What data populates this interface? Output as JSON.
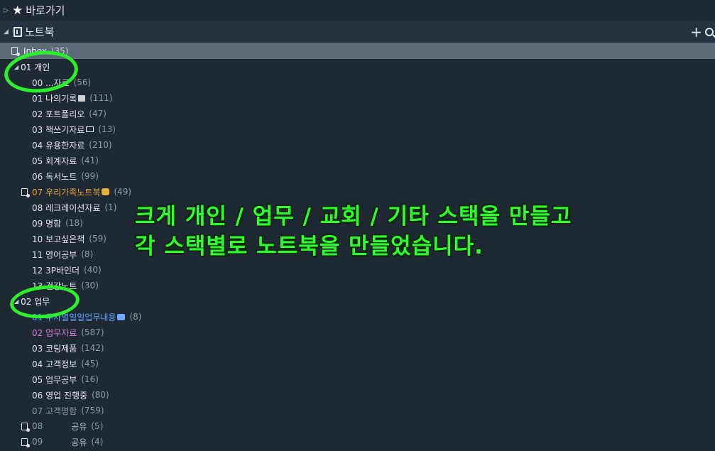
{
  "favorites": {
    "label": "바로가기"
  },
  "notebooks_header": {
    "label": "노트북"
  },
  "inbox": {
    "label": "Inbox",
    "count": "(35)"
  },
  "stacks": {
    "personal": {
      "label": "01 개인",
      "notebooks": [
        {
          "label": "00 ...자료",
          "count": "(56)"
        },
        {
          "label": "01 나의기록",
          "count": "(111)"
        },
        {
          "label": "02 포트폴리오",
          "count": "(47)"
        },
        {
          "label": "03 책쓰기자료",
          "count": "(13)"
        },
        {
          "label": "04 유용한자료",
          "count": "(210)"
        },
        {
          "label": "05 회계자료",
          "count": "(41)"
        },
        {
          "label": "06 독서노트",
          "count": "(99)"
        },
        {
          "label": "07 우리가족노트북",
          "count": "(49)"
        },
        {
          "label": "08 레크레이션자료",
          "count": "(1)"
        },
        {
          "label": "09 명함",
          "count": "(18)"
        },
        {
          "label": "10 보고싶은책",
          "count": "(59)"
        },
        {
          "label": "11 영어공부",
          "count": "(8)"
        },
        {
          "label": "12 3P바인더",
          "count": "(40)"
        },
        {
          "label": "13 건강노트",
          "count": "(30)"
        }
      ]
    },
    "work": {
      "label": "02 업무",
      "notebooks": [
        {
          "label": "01 주차별일일업무내용",
          "count": "(8)"
        },
        {
          "label": "02 업무자료",
          "count": "(587)"
        },
        {
          "label": "03 코팅제품",
          "count": "(142)"
        },
        {
          "label": "04 고객정보",
          "count": "(45)"
        },
        {
          "label": "05 업무공부",
          "count": "(16)"
        },
        {
          "label": "06 영업 진행중",
          "count": "(80)"
        },
        {
          "label": "07 고객명함",
          "count": "(759)"
        }
      ]
    },
    "shared": [
      {
        "prefix": "08",
        "label": "공유",
        "count": "(5)"
      },
      {
        "prefix": "09",
        "label": "공유",
        "count": "(4)"
      }
    ]
  },
  "annotation": {
    "line1": "크게 개인 / 업무 / 교회 / 기타 스택을 만들고",
    "line2": "각 스택별로 노트북을 만들었습니다."
  },
  "colors": {
    "orange_notebook": "#e7a53a",
    "blue_notebook": "#5aa0ff",
    "pink_notebook": "#d77fd0",
    "annotation_green": "#2cff2c"
  }
}
